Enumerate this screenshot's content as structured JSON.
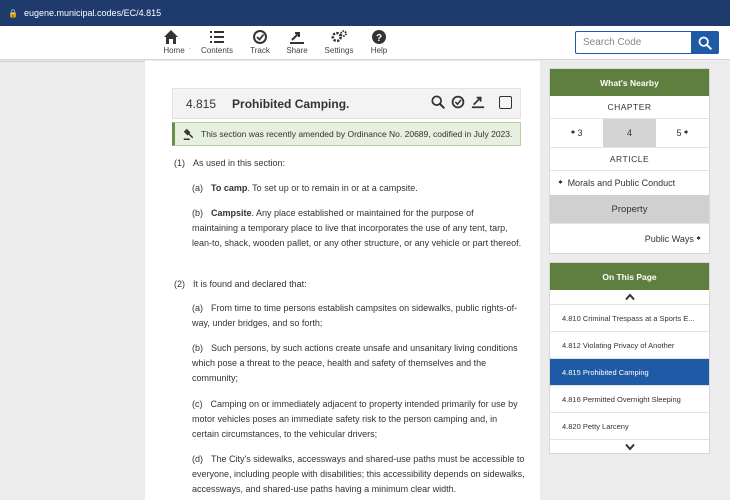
{
  "browser": {
    "url": "eugene.municipal.codes/EC/4.815"
  },
  "nav": {
    "items": [
      {
        "label": "Home",
        "icon": "home-icon"
      },
      {
        "label": "Contents",
        "icon": "list-icon"
      },
      {
        "label": "Track",
        "icon": "track-icon"
      },
      {
        "label": "Share",
        "icon": "share-icon"
      },
      {
        "label": "Settings",
        "icon": "gear-icon"
      },
      {
        "label": "Help",
        "icon": "help-icon"
      }
    ],
    "separator": "."
  },
  "search": {
    "placeholder": "Search Code",
    "value": ""
  },
  "section": {
    "number": "4.815",
    "title": "Prohibited Camping.",
    "amend_note": "This section was recently amended by Ordinance No. 20689, codified in July 2023."
  },
  "body": {
    "p1": {
      "label": "(1)",
      "text": "As used in this section:"
    },
    "p1a": {
      "label": "(a)",
      "term": "To camp",
      "text": ". To set up or to remain in or at a campsite."
    },
    "p1b": {
      "label": "(b)",
      "term": "Campsite",
      "text": ". Any place established or maintained for the purpose of maintaining a temporary place to live that incorporates the use of any tent, tarp, lean-to, shack, wooden pallet, or any other structure, or any vehicle or part thereof."
    },
    "p2": {
      "label": "(2)",
      "text": "It is found and declared that:"
    },
    "p2a": {
      "label": "(a)",
      "text": "From time to time persons establish campsites on sidewalks, public rights-of-way, under bridges, and so forth;"
    },
    "p2b": {
      "label": "(b)",
      "text": "Such persons, by such actions create unsafe and unsanitary living conditions which pose a threat to the peace, health and safety of themselves and the community;"
    },
    "p2c": {
      "label": "(c)",
      "text": "Camping on or immediately adjacent to property intended primarily for use by motor vehicles poses an immediate safety risk to the person camping and, in certain circumstances, to the vehicular drivers;"
    },
    "p2d": {
      "label": "(d)",
      "text": "The City's sidewalks, accessways and shared-use paths must be accessible to everyone, including people with disabilities; this accessibility depends on sidewalks, accessways, and shared-use paths having a minimum clear width."
    }
  },
  "nearby": {
    "title": "What's Nearby",
    "chapter_label": "CHAPTER",
    "prev": "3",
    "current": "4",
    "next": "5",
    "article_label": "ARTICLE",
    "prev_article": "Morals and Public Conduct",
    "current_article": "Property",
    "next_article": "Public Ways"
  },
  "on_this_page": {
    "title": "On This Page",
    "items": [
      "4.810 Criminal Trespass at a Sports E...",
      "4.812 Violating Privacy of Another",
      "4.815 Prohibited Camping",
      "4.816 Permitted Overnight Sleeping",
      "4.820 Petty Larceny"
    ]
  }
}
